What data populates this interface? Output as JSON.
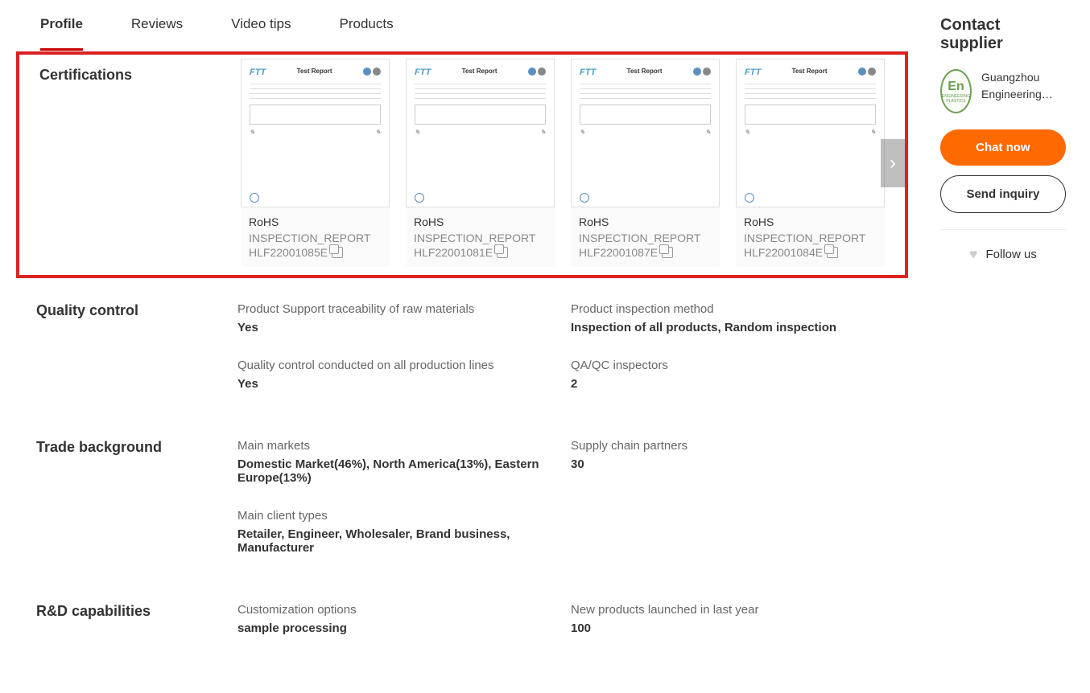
{
  "tabs": {
    "profile": "Profile",
    "reviews": "Reviews",
    "video_tips": "Video tips",
    "products": "Products"
  },
  "certifications": {
    "title": "Certifications",
    "report_label": "Test Report",
    "brand": "FTT",
    "items": [
      {
        "type": "RoHS",
        "name": "INSPECTION_REPORT",
        "code": "HLF22001085E"
      },
      {
        "type": "RoHS",
        "name": "INSPECTION_REPORT",
        "code": "HLF22001081E"
      },
      {
        "type": "RoHS",
        "name": "INSPECTION_REPORT",
        "code": "HLF22001087E"
      },
      {
        "type": "RoHS",
        "name": "INSPECTION_REPORT",
        "code": "HLF22001084E"
      }
    ]
  },
  "quality_control": {
    "title": "Quality control",
    "items": [
      {
        "label": "Product Support traceability of raw materials",
        "value": "Yes"
      },
      {
        "label": "Product inspection method",
        "value": "Inspection of all products, Random inspection"
      },
      {
        "label": "Quality control conducted on all production lines",
        "value": "Yes"
      },
      {
        "label": "QA/QC inspectors",
        "value": "2"
      }
    ]
  },
  "trade_background": {
    "title": "Trade background",
    "items": [
      {
        "label": "Main markets",
        "value": "Domestic Market(46%), North America(13%), Eastern Europe(13%)"
      },
      {
        "label": "Supply chain partners",
        "value": "30"
      },
      {
        "label": "Main client types",
        "value": "Retailer, Engineer, Wholesaler, Brand business, Manufacturer"
      }
    ]
  },
  "rd_capabilities": {
    "title": "R&D capabilities",
    "items": [
      {
        "label": "Customization options",
        "value": "sample processing"
      },
      {
        "label": "New products launched in last year",
        "value": "100"
      }
    ]
  },
  "sidebar": {
    "title": "Contact supplier",
    "logo_main": "En",
    "logo_sub": "ENGINEERING PLASTICS",
    "supplier_name": "Guangzhou Engineering…",
    "chat_now": "Chat now",
    "send_inquiry": "Send inquiry",
    "follow_us": "Follow us"
  }
}
